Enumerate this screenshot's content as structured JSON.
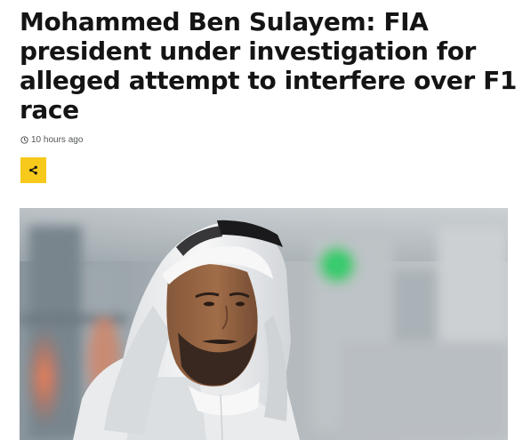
{
  "article": {
    "headline": "Mohammed Ben Sulayem: FIA president under investigation for alleged attempt to interfere over F1 race",
    "timestamp": "10 hours ago",
    "share_icon": "share-icon",
    "clock_icon": "clock-icon"
  },
  "colors": {
    "share_button_bg": "#f6c91b",
    "headline": "#141414",
    "meta": "#545658"
  }
}
